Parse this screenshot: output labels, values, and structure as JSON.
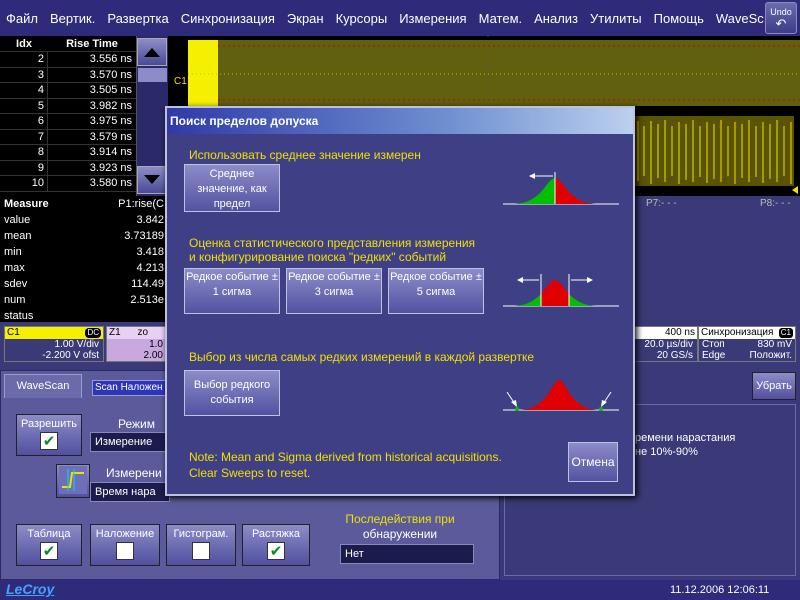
{
  "menu": {
    "items": [
      "Файл",
      "Вертик.",
      "Развертка",
      "Синхронизация",
      "Экран",
      "Курсоры",
      "Измерения",
      "Матем.",
      "Анализ",
      "Утилиты",
      "Помощь",
      "WaveSc..."
    ],
    "undo_label": "Undo"
  },
  "table": {
    "col_idx": "Idx",
    "col_rise": "Rise Time",
    "rows": [
      {
        "idx": "2",
        "val": "3.556 ns"
      },
      {
        "idx": "3",
        "val": "3.570 ns"
      },
      {
        "idx": "4",
        "val": "3.505 ns"
      },
      {
        "idx": "5",
        "val": "3.982 ns"
      },
      {
        "idx": "6",
        "val": "3.975 ns"
      },
      {
        "idx": "7",
        "val": "3.579 ns"
      },
      {
        "idx": "8",
        "val": "3.914 ns"
      },
      {
        "idx": "9",
        "val": "3.923 ns"
      },
      {
        "idx": "10",
        "val": "3.580 ns"
      }
    ]
  },
  "measure": {
    "header": "Measure",
    "param": "P1:rise(C",
    "rows": [
      {
        "label": "value",
        "val": "3.842"
      },
      {
        "label": "mean",
        "val": "3.73189"
      },
      {
        "label": "min",
        "val": "3.418"
      },
      {
        "label": "max",
        "val": "4.213"
      },
      {
        "label": "sdev",
        "val": "114.49"
      },
      {
        "label": "num",
        "val": "2.513e"
      },
      {
        "label": "status",
        "val": ""
      }
    ]
  },
  "waveform": {
    "c1_label": "C1",
    "p7": "P7:- - -",
    "p8": "P8:- - -"
  },
  "channels": {
    "c1": {
      "name": "C1",
      "coupling": "DC",
      "vdiv": "1.00 V/div",
      "offset": "-2.200 V ofst"
    },
    "z1": {
      "name": "Z1",
      "short": "zo",
      "line1": "1.0",
      "line2": "2.00"
    },
    "timebase": {
      "tdiv": "400 ns",
      "line1": "20.0 µs/div",
      "line2": "20 GS/s"
    },
    "trigger": {
      "title": "Синхронизация",
      "ch": "C1",
      "mode": "Стоп",
      "level": "830 mV",
      "type": "Edge",
      "slope": "Положит."
    }
  },
  "bottom": {
    "tab_wavescan": "WaveScan",
    "tab_scan_overlay": "Scan Наложен",
    "enable_label": "Разрешить",
    "enable_checked": true,
    "mode_label": "Режим",
    "mode_value": "Измерение",
    "meas_label": "Измерени",
    "meas_value": "Время нара",
    "table_label": "Таблица",
    "table_checked": true,
    "overlay_label": "Наложение",
    "overlay_checked": false,
    "hist_label": "Гистограм.",
    "hist_checked": false,
    "stretch_label": "Растяжка",
    "stretch_checked": true,
    "actions_label_1": "Последействия при",
    "actions_label_2": "обнаружении",
    "actions_value": "Нет",
    "remove_button": "Убрать",
    "right_text_1": "ремени нарастания",
    "right_text_2": "не 10%-90%"
  },
  "dialog": {
    "title": "Поиск пределов допуска",
    "section1_label": "Использовать среднее значение измерен",
    "btn_mean": "Среднее значение, как предел",
    "section2_label_1": "Оценка статистического представления измерения",
    "section2_label_2": "и конфигурирование поиска \"редких\" событий",
    "btn_sigma1": "Редкое событие ± 1 сигма",
    "btn_sigma3": "Редкое событие ± 3 сигма",
    "btn_sigma5": "Редкое событие ± 5 сигма",
    "section3_label": "Выбор из числа самых редких измерений в каждой развертке",
    "btn_rare": "Выбор редкого события",
    "note_1": "Note: Mean and Sigma derived from historical acquisitions.",
    "note_2": "Clear Sweeps to reset.",
    "cancel": "Отмена"
  },
  "status": {
    "logo": "LeCroy",
    "datetime": "11.12.2006 12:06:11"
  },
  "colors": {
    "accent_yellow": "#f0e000",
    "bell_green": "#00c000",
    "bell_red": "#e00000"
  }
}
